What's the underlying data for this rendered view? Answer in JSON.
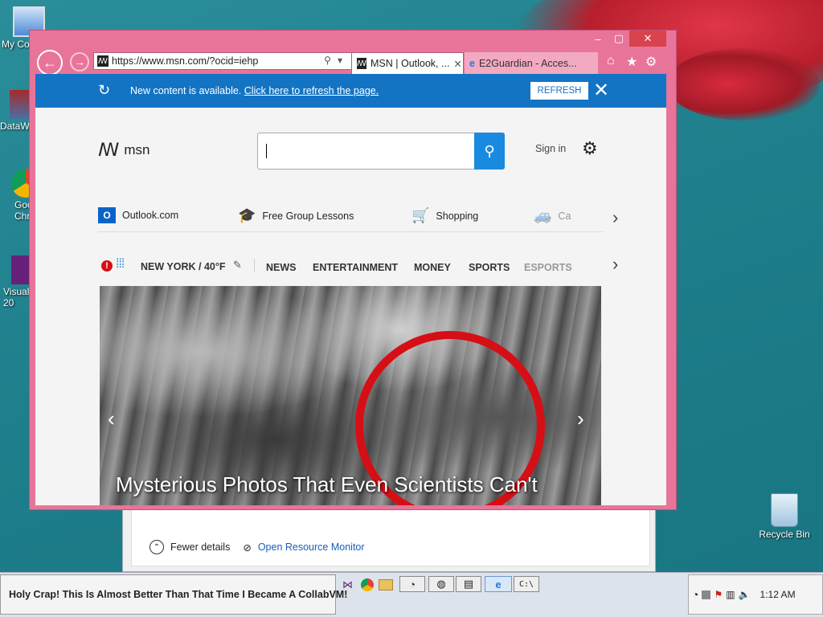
{
  "desktop": {
    "icons": [
      {
        "label": "My Co",
        "icon": "computer-icon"
      },
      {
        "label": "DataW",
        "icon": "shortcut-icon"
      },
      {
        "label": "Goo Chr",
        "icon": "chrome-icon"
      },
      {
        "label": "Visual 20",
        "icon": "visual-studio-icon"
      },
      {
        "label": "Recycle Bin",
        "icon": "recycle-bin-icon"
      }
    ]
  },
  "background_window": {
    "fewer_details": "Fewer details",
    "open_resource_monitor": "Open Resource Monitor"
  },
  "browser": {
    "address": "https://www.msn.com/?ocid=iehp",
    "tabs": [
      {
        "label": "MSN | Outlook, ...",
        "active": true
      },
      {
        "label": "E2Guardian - Acces...",
        "active": false
      }
    ],
    "banner": {
      "message": "New content is available.",
      "link": "Click here to refresh the page.",
      "button": "REFRESH"
    },
    "page": {
      "logo": "msn",
      "signin": "Sign in",
      "quick_links": [
        {
          "label": "Outlook.com",
          "icon": "outlook-icon"
        },
        {
          "label": "Free Group Lessons",
          "icon": "graduation-cap-icon"
        },
        {
          "label": "Shopping",
          "icon": "shopping-cart-icon"
        },
        {
          "label": "Ca",
          "icon": "car-icon"
        }
      ],
      "weather": "NEW YORK / 40°F",
      "nav": [
        "NEWS",
        "ENTERTAINMENT",
        "MONEY",
        "SPORTS",
        "ESPORTS"
      ],
      "hero_caption": "Mysterious Photos That Even Scientists Can't"
    }
  },
  "taskbar": {
    "title": "Holy Crap! This Is Almost Better Than That Time I Became A CollabVM!",
    "clock": "1:12 AM"
  },
  "colors": {
    "ie_frame": "#e8749a",
    "banner": "#1474c4",
    "search_button": "#1a8ae0",
    "hero_ring": "#d60f16"
  }
}
